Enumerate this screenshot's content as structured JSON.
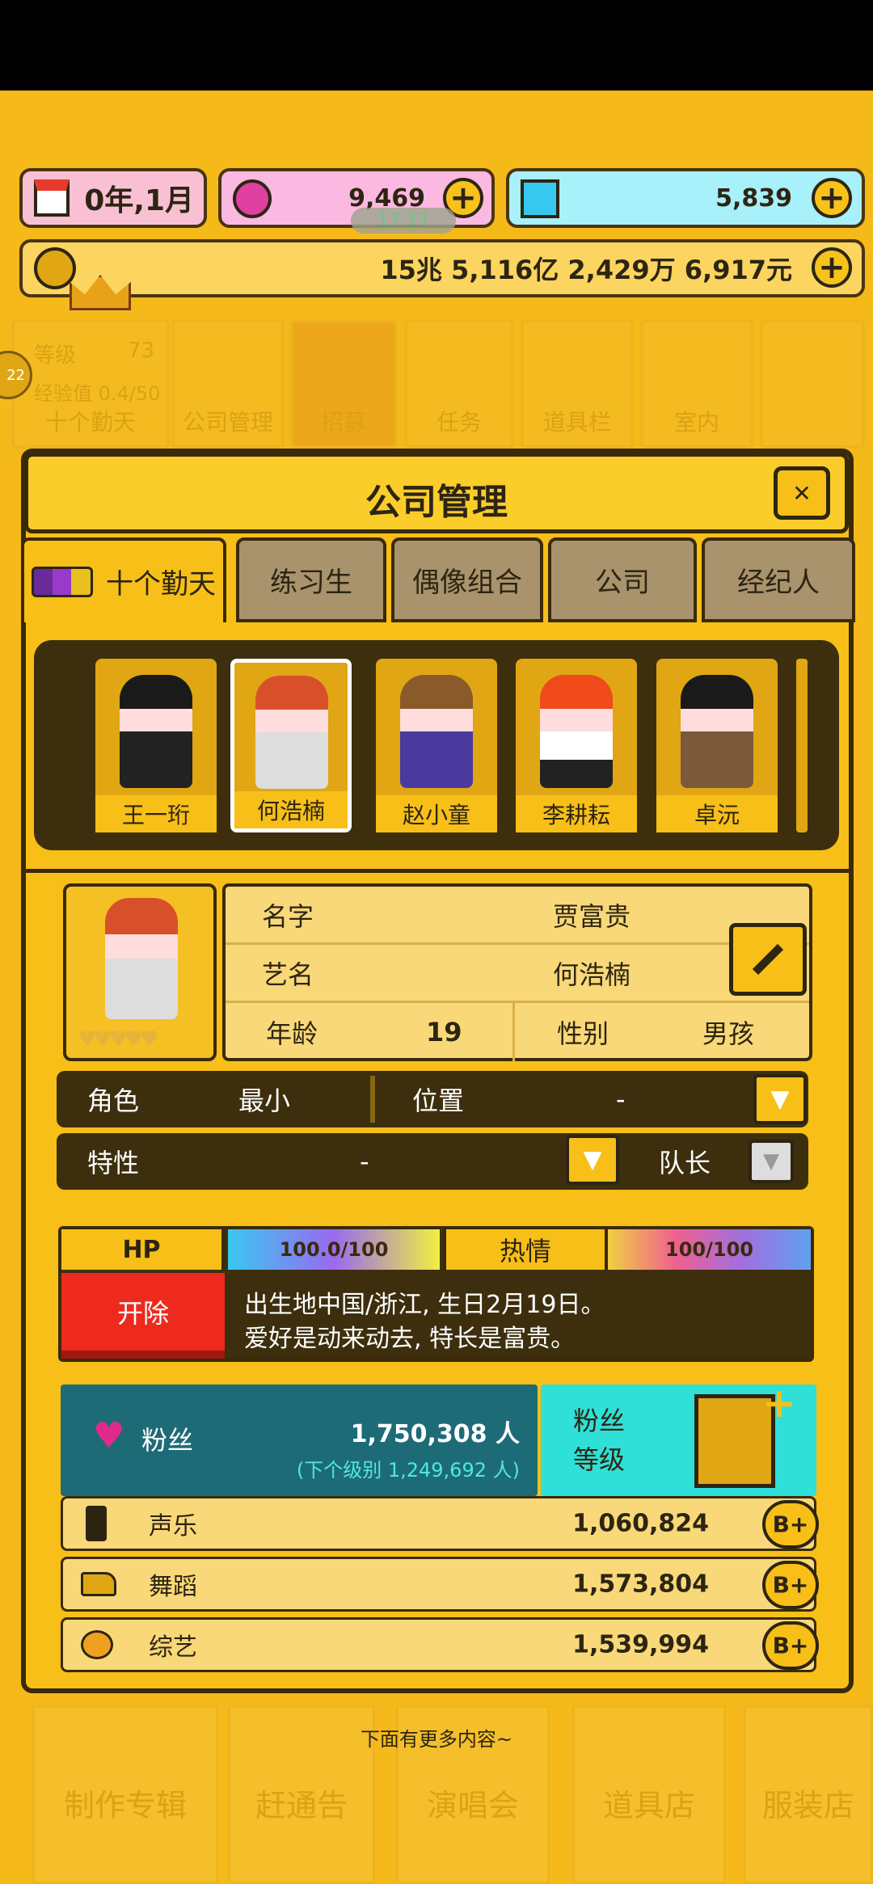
{
  "top": {
    "date": "0年,1月",
    "pink_currency": "9,469",
    "blue_currency": "5,839",
    "overlay_text": "17:17",
    "money": "15兆 5,116亿 2,429万 6,917元"
  },
  "background_menu": {
    "level_label": "等级",
    "level_value": "73",
    "exp_label": "经验值 0.4/50",
    "group_name": "十个勤天",
    "level_badge": "22",
    "items": [
      "公司管理",
      "招募",
      "任务",
      "道具栏",
      "室内"
    ]
  },
  "panel": {
    "title": "公司管理",
    "close_icon": "close-icon",
    "tabs": [
      "十个勤天",
      "练习生",
      "偶像组合",
      "公司",
      "经纪人"
    ]
  },
  "members": [
    "王一珩",
    "何浩楠",
    "赵小童",
    "李耕耘",
    "卓沅"
  ],
  "profile": {
    "name_label": "名字",
    "name_value": "贾富贵",
    "stage_label": "艺名",
    "stage_value": "何浩楠",
    "age_label": "年龄",
    "age_value": "19",
    "gender_label": "性别",
    "gender_value": "男孩",
    "role_label": "角色",
    "role_value": "最小",
    "position_label": "位置",
    "position_value": "-",
    "trait_label": "特性",
    "trait_value": "-",
    "leader_label": "队长"
  },
  "status": {
    "hp_label": "HP",
    "hp_value": "100.0/100",
    "passion_label": "热情",
    "passion_value": "100/100",
    "fire_button": "开除",
    "bio_line1": "出生地中国/浙江, 生日2月19日。",
    "bio_line2": "爱好是动来动去, 特长是富贵。"
  },
  "fans": {
    "label": "粉丝",
    "count": "1,750,308 人",
    "next": "(下个级别 1,249,692 人)",
    "level_label_1": "粉丝",
    "level_label_2": "等级"
  },
  "stats": [
    {
      "label": "声乐",
      "value": "1,060,824",
      "grade": "B+"
    },
    {
      "label": "舞蹈",
      "value": "1,573,804",
      "grade": "B+"
    },
    {
      "label": "综艺",
      "value": "1,539,994",
      "grade": "B+"
    }
  ],
  "more_hint": "下面有更多内容~",
  "bottom_menu": [
    "制作专辑",
    "赶通告",
    "演唱会",
    "道具店",
    "服装店"
  ],
  "colors": {
    "accent_yellow": "#f7bf18",
    "dark_brown": "#3d2f0e",
    "fans_teal": "#1e6b78",
    "fans_cyan": "#2fe0d8",
    "fire_red": "#ee2a1e"
  }
}
